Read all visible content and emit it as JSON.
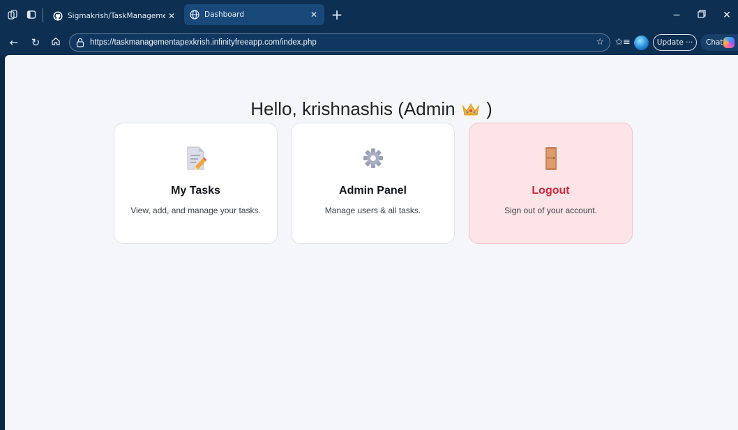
{
  "browser": {
    "tabs": [
      {
        "title": "Sigmakrish/TaskManagementSyst",
        "favicon": "github-icon",
        "active": false
      },
      {
        "title": "Dashboard",
        "favicon": "globe-icon",
        "active": true
      }
    ],
    "url": "https://taskmanagementapexkrish.infinityfreeapp.com/index.php",
    "update_label": "Update ···",
    "chat_label": "Chat",
    "accent": "#0c2f52"
  },
  "page": {
    "greeting_prefix": "Hello, krishnashis (Admin",
    "greeting_suffix": ")",
    "cards": [
      {
        "id": "my-tasks",
        "icon": "document-pencil-icon",
        "title": "My Tasks",
        "description": "View, add, and manage your tasks."
      },
      {
        "id": "admin-panel",
        "icon": "gear-icon",
        "title": "Admin Panel",
        "description": "Manage users & all tasks."
      },
      {
        "id": "logout",
        "icon": "door-icon",
        "title": "Logout",
        "description": "Sign out of your account.",
        "color": "#d1293a"
      }
    ]
  }
}
